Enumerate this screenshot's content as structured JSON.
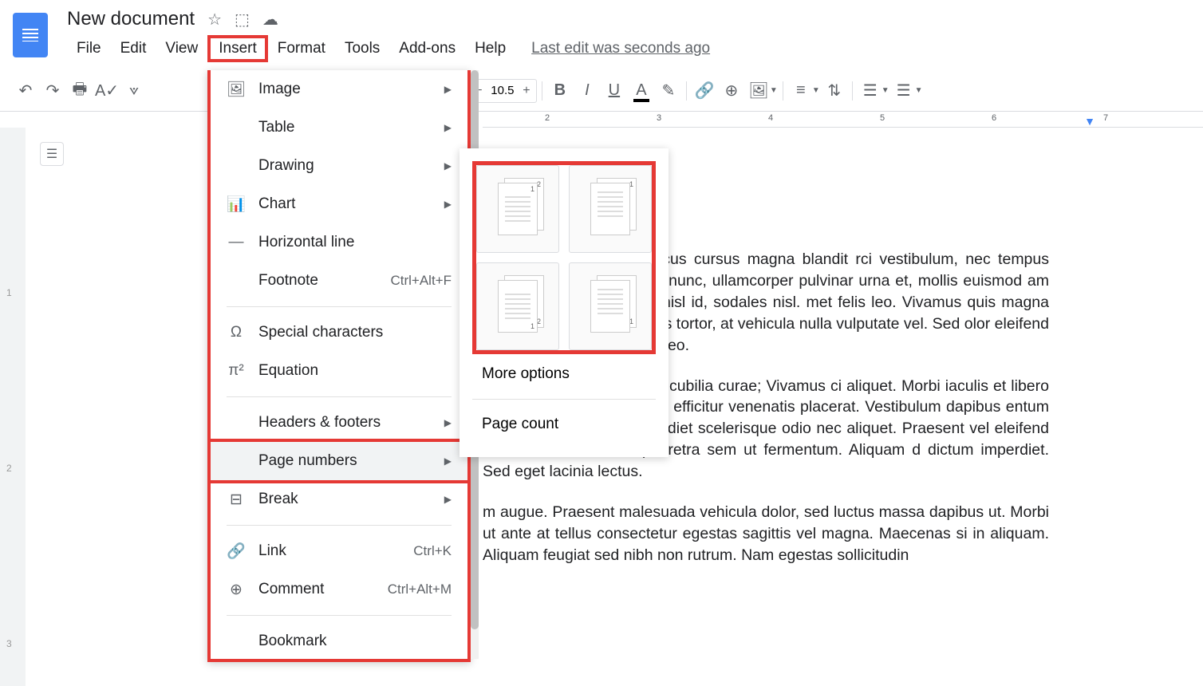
{
  "document": {
    "title": "New document",
    "lastEdit": "Last edit was seconds ago"
  },
  "menuBar": {
    "file": "File",
    "edit": "Edit",
    "view": "View",
    "insert": "Insert",
    "format": "Format",
    "tools": "Tools",
    "addons": "Add-ons",
    "help": "Help"
  },
  "toolbar": {
    "fontSize": "10.5"
  },
  "insertMenu": {
    "image": "Image",
    "table": "Table",
    "drawing": "Drawing",
    "chart": "Chart",
    "horizontalLine": "Horizontal line",
    "footnote": "Footnote",
    "footnoteShortcut": "Ctrl+Alt+F",
    "specialCharacters": "Special characters",
    "equation": "Equation",
    "headersFooters": "Headers & footers",
    "pageNumbers": "Page numbers",
    "break": "Break",
    "link": "Link",
    "linkShortcut": "Ctrl+K",
    "comment": "Comment",
    "commentShortcut": "Ctrl+Alt+M",
    "bookmark": "Bookmark"
  },
  "submenu": {
    "moreOptions": "More options",
    "pageCount": "Page count"
  },
  "ruler": {
    "marks": [
      "2",
      "3",
      "4",
      "5",
      "6",
      "7"
    ]
  },
  "gutter": {
    "marks": [
      "1",
      "2",
      "3"
    ]
  },
  "documentBody": {
    "p1": "iscing elit. Praesent rhoncus cursus magna blandit rci vestibulum, nec tempus arcu convallis. Praesent s nunc, ullamcorper pulvinar urna et, mollis euismod am ac nulla pharetra, finibus nisl id, sodales nisl. met felis leo. Vivamus quis magna nibh. Vestibulum rius varius tortor, at vehicula nulla vulputate vel. Sed olor eleifend est cursus lobortis non eu leo.",
    "p2": "i luctus et ultrices posuere cubilia curae; Vivamus ci aliquet. Morbi iaculis et libero nec ultrices. Sed non usce efficitur venenatis placerat. Vestibulum dapibus entum mi blandit in. Mauris imperdiet scelerisque odio nec aliquet. Praesent vel eleifend urna. Vivamus iaculis pharetra sem ut fermentum. Aliquam d dictum imperdiet. Sed eget lacinia lectus.",
    "p3": "m augue. Praesent malesuada vehicula dolor, sed luctus massa dapibus ut. Morbi ut ante at tellus consectetur egestas sagittis vel magna. Maecenas si in aliquam. Aliquam feugiat sed nibh non rutrum. Nam egestas sollicitudin"
  }
}
